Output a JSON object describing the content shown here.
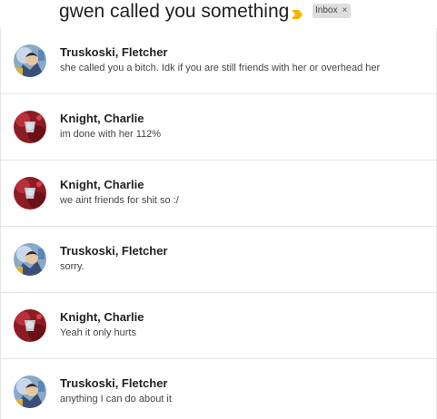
{
  "subject": {
    "title": "gwen called you something",
    "importance_icon": "importance-marker-icon",
    "importance_color": "#f4b400",
    "label": "Inbox",
    "label_close": "×"
  },
  "messages": [
    {
      "sender": "Truskoski, Fletcher",
      "snippet": "she called you a bitch. Idk if you are still friends with her or overhead her",
      "avatar": "avatar-fletcher"
    },
    {
      "sender": "Knight, Charlie",
      "snippet": "im done with her 112%",
      "avatar": "avatar-charlie"
    },
    {
      "sender": "Knight, Charlie",
      "snippet": "we aint friends for shit so :/",
      "avatar": "avatar-charlie"
    },
    {
      "sender": "Truskoski, Fletcher",
      "snippet": "sorry.",
      "avatar": "avatar-fletcher"
    },
    {
      "sender": "Knight, Charlie",
      "snippet": "Yeah it only hurts",
      "avatar": "avatar-charlie"
    },
    {
      "sender": "Truskoski, Fletcher",
      "snippet": "anything I can do about it",
      "avatar": "avatar-fletcher"
    }
  ]
}
